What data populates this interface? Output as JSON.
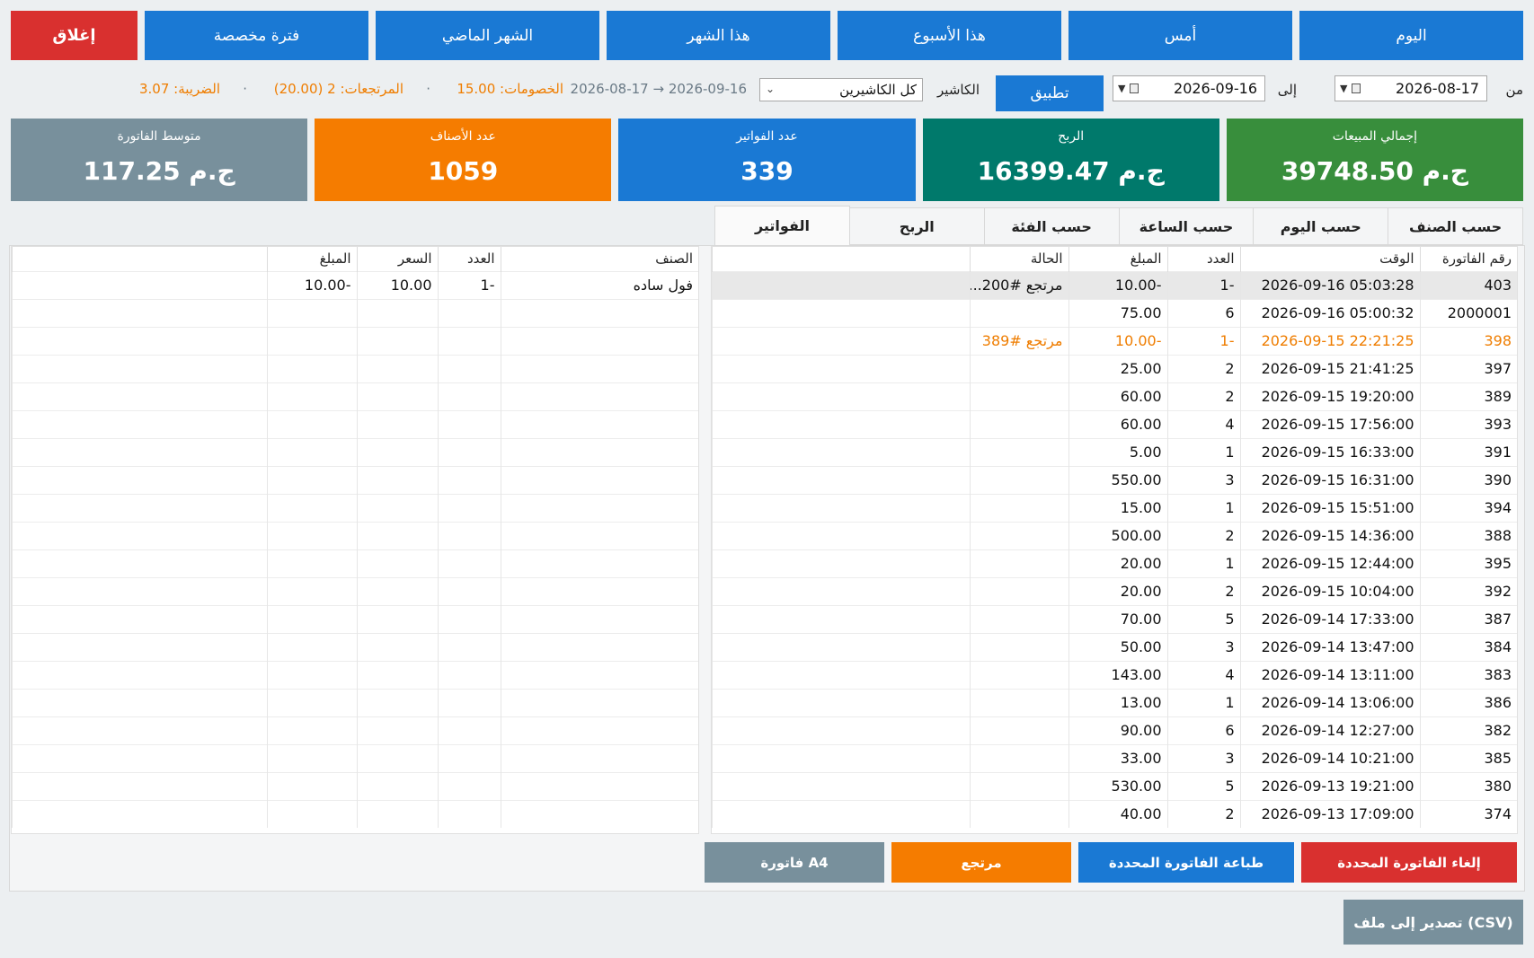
{
  "periods": {
    "today": "اليوم",
    "yesterday": "أمس",
    "this_week": "هذا الأسبوع",
    "this_month": "هذا الشهر",
    "last_month": "الشهر الماضي",
    "custom": "فترة مخصصة",
    "close": "إغلاق"
  },
  "filter": {
    "from_label": "من",
    "from_date": "2026-08-17",
    "to_label": "إلى",
    "to_date": "2026-09-16",
    "apply": "تطبيق",
    "cashier_label": "الكاشير",
    "cashier_value": "كل الكاشيرين",
    "range_text": "2026-08-17 → 2026-09-16",
    "discounts": "الخصومات: 15.00",
    "returns": "المرتجعات: 2 (20.00)",
    "tax": "الضريبة: 3.07",
    "sep": "·"
  },
  "colors": {
    "blue": "#1a79d4",
    "red": "#d9302f",
    "orange": "#f57c00",
    "green": "#388e3c",
    "teal": "#00796b",
    "gray": "#78909c"
  },
  "cards": [
    {
      "title": "إجمالي المبيعات",
      "value": "39748.50 ج.م",
      "color": "#388e3c"
    },
    {
      "title": "الربح",
      "value": "16399.47 ج.م",
      "color": "#00796b"
    },
    {
      "title": "عدد الفواتير",
      "value": "339",
      "color": "#1a79d4"
    },
    {
      "title": "عدد الأصناف",
      "value": "1059",
      "color": "#f57c00"
    },
    {
      "title": "متوسط الفاتورة",
      "value": "117.25 ج.م",
      "color": "#78909c"
    }
  ],
  "tabs": [
    "حسب الصنف",
    "حسب اليوم",
    "حسب الساعة",
    "حسب الفئة",
    "الربح",
    "الفواتير"
  ],
  "invoices": {
    "headers": [
      "رقم الفاتورة",
      "الوقت",
      "العدد",
      "المبلغ",
      "الحالة",
      ""
    ],
    "rows": [
      {
        "id": "403",
        "time": "2026-09-16 05:03:28",
        "qty": "-1",
        "amount": "-10.00",
        "status": "مرتجع #200...",
        "style": "sel"
      },
      {
        "id": "2000001",
        "time": "2026-09-16 05:00:32",
        "qty": "6",
        "amount": "75.00",
        "status": "",
        "style": ""
      },
      {
        "id": "398",
        "time": "2026-09-15 22:21:25",
        "qty": "-1",
        "amount": "-10.00",
        "status": "مرتجع #389",
        "style": "ret"
      },
      {
        "id": "397",
        "time": "2026-09-15 21:41:25",
        "qty": "2",
        "amount": "25.00",
        "status": "",
        "style": ""
      },
      {
        "id": "389",
        "time": "2026-09-15 19:20:00",
        "qty": "2",
        "amount": "60.00",
        "status": "",
        "style": ""
      },
      {
        "id": "393",
        "time": "2026-09-15 17:56:00",
        "qty": "4",
        "amount": "60.00",
        "status": "",
        "style": ""
      },
      {
        "id": "391",
        "time": "2026-09-15 16:33:00",
        "qty": "1",
        "amount": "5.00",
        "status": "",
        "style": ""
      },
      {
        "id": "390",
        "time": "2026-09-15 16:31:00",
        "qty": "3",
        "amount": "550.00",
        "status": "",
        "style": ""
      },
      {
        "id": "394",
        "time": "2026-09-15 15:51:00",
        "qty": "1",
        "amount": "15.00",
        "status": "",
        "style": ""
      },
      {
        "id": "388",
        "time": "2026-09-15 14:36:00",
        "qty": "2",
        "amount": "500.00",
        "status": "",
        "style": ""
      },
      {
        "id": "395",
        "time": "2026-09-15 12:44:00",
        "qty": "1",
        "amount": "20.00",
        "status": "",
        "style": ""
      },
      {
        "id": "392",
        "time": "2026-09-15 10:04:00",
        "qty": "2",
        "amount": "20.00",
        "status": "",
        "style": ""
      },
      {
        "id": "387",
        "time": "2026-09-14 17:33:00",
        "qty": "5",
        "amount": "70.00",
        "status": "",
        "style": ""
      },
      {
        "id": "384",
        "time": "2026-09-14 13:47:00",
        "qty": "3",
        "amount": "50.00",
        "status": "",
        "style": ""
      },
      {
        "id": "383",
        "time": "2026-09-14 13:11:00",
        "qty": "4",
        "amount": "143.00",
        "status": "",
        "style": ""
      },
      {
        "id": "386",
        "time": "2026-09-14 13:06:00",
        "qty": "1",
        "amount": "13.00",
        "status": "",
        "style": ""
      },
      {
        "id": "382",
        "time": "2026-09-14 12:27:00",
        "qty": "6",
        "amount": "90.00",
        "status": "",
        "style": ""
      },
      {
        "id": "385",
        "time": "2026-09-14 10:21:00",
        "qty": "3",
        "amount": "33.00",
        "status": "",
        "style": ""
      },
      {
        "id": "380",
        "time": "2026-09-13 19:21:00",
        "qty": "5",
        "amount": "530.00",
        "status": "",
        "style": ""
      },
      {
        "id": "374",
        "time": "2026-09-13 17:09:00",
        "qty": "2",
        "amount": "40.00",
        "status": "",
        "style": ""
      }
    ]
  },
  "details": {
    "headers": [
      "الصنف",
      "العدد",
      "السعر",
      "المبلغ",
      ""
    ],
    "rows": [
      {
        "item": "فول ساده",
        "qty": "-1",
        "price": "10.00",
        "amount": "-10.00"
      }
    ]
  },
  "actions": {
    "cancel": "إلغاء الفاتورة المحددة",
    "print": "طباعة الفاتورة المحددة",
    "return": "مرتجع",
    "a4": "فاتورة A4",
    "export": "تصدير إلى ملف (CSV)"
  }
}
